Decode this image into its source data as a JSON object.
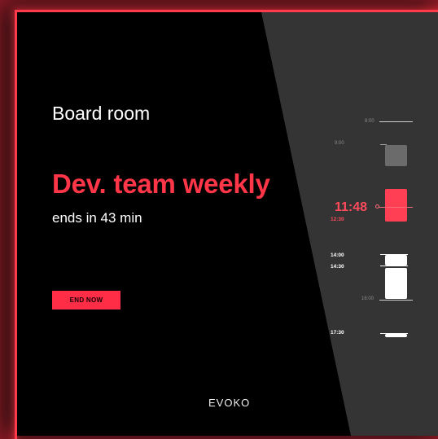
{
  "room": {
    "name": "Board room"
  },
  "meeting": {
    "title": "Dev. team weekly",
    "remaining": "ends in 43 min"
  },
  "actions": {
    "end_now": "END NOW"
  },
  "brand": {
    "logo": "EVOKO"
  },
  "colors": {
    "accent": "#ff3548",
    "background": "#000000",
    "panel": "#343434"
  },
  "timeline": {
    "current_time": "11:48",
    "current_meeting_end": "12:30",
    "labels": {
      "t0800": "8:00",
      "t0900": "9:00",
      "t1400": "14:00",
      "t1430": "14:30",
      "t1600": "16:00",
      "t1730": "17:30"
    }
  }
}
